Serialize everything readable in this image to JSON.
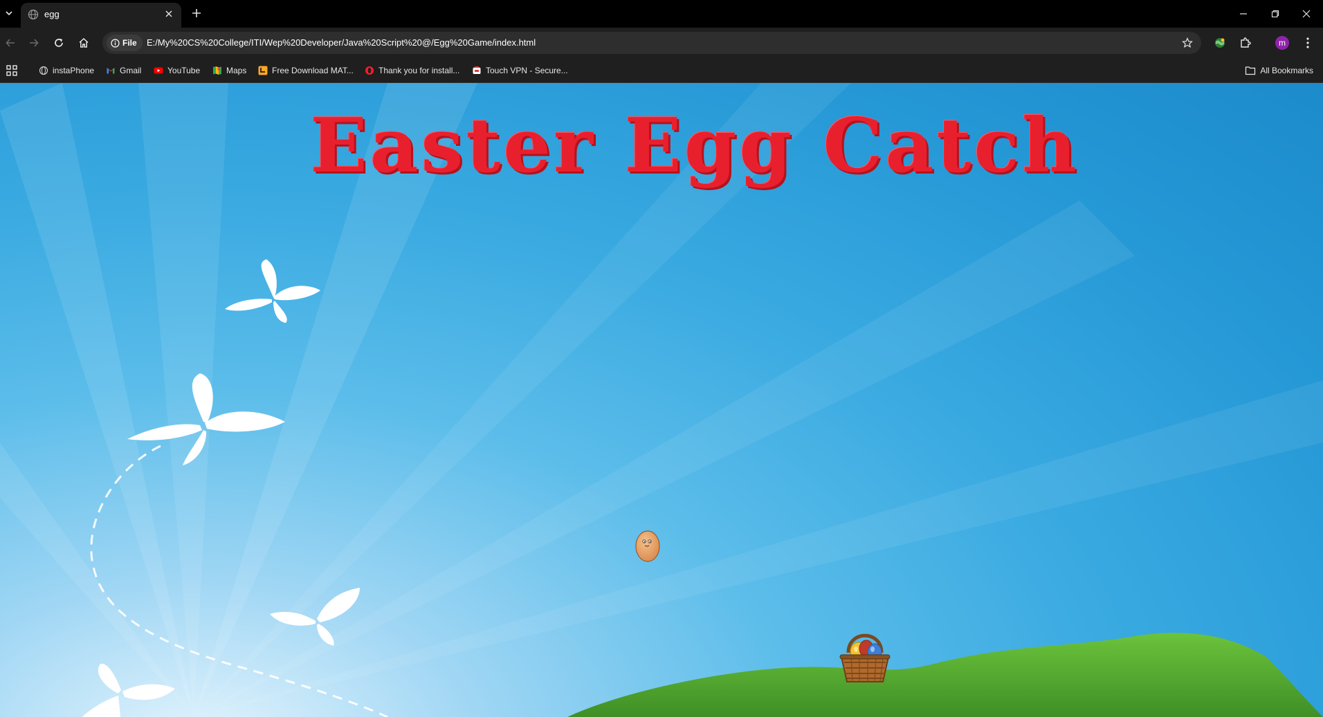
{
  "browser": {
    "tab": {
      "title": "egg"
    },
    "address_bar": {
      "site_chip_label": "File",
      "url": "E:/My%20CS%20College/ITI/Wep%20Developer/Java%20Script%20@/Egg%20Game/index.html"
    },
    "profile": {
      "initial": "m",
      "color": "#8e24aa"
    },
    "bookmarks": [
      {
        "label": "instaPhone",
        "icon": "globe-icon"
      },
      {
        "label": "Gmail",
        "icon": "gmail-icon"
      },
      {
        "label": "YouTube",
        "icon": "youtube-icon"
      },
      {
        "label": "Maps",
        "icon": "maps-icon"
      },
      {
        "label": "Free Download MAT...",
        "icon": "download-site-icon"
      },
      {
        "label": "Thank you for install...",
        "icon": "opera-icon"
      },
      {
        "label": "Touch VPN - Secure...",
        "icon": "vpn-icon"
      }
    ],
    "all_bookmarks_label": "All Bookmarks"
  },
  "game": {
    "title": "Easter Egg Catch",
    "title_color": "#e8202e",
    "sky_color": "#2598d6",
    "hill_color": "#5aa832"
  }
}
